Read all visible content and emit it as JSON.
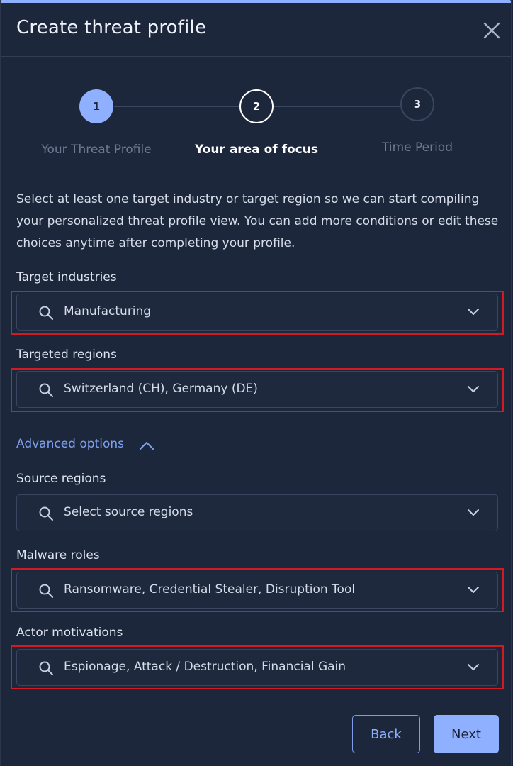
{
  "dialog": {
    "title": "Create threat profile"
  },
  "stepper": {
    "steps": [
      {
        "number": "1",
        "label": "Your Threat Profile",
        "state": "completed"
      },
      {
        "number": "2",
        "label": "Your area of focus",
        "state": "active"
      },
      {
        "number": "3",
        "label": "Time Period",
        "state": "upcoming"
      }
    ]
  },
  "description": "Select at least one target industry or target region so we can start compiling your personalized threat profile view. You can add more conditions or edit these choices anytime after completing your profile.",
  "fields": {
    "target_industries": {
      "label": "Target industries",
      "value": "Manufacturing"
    },
    "targeted_regions": {
      "label": "Targeted regions",
      "value": "Switzerland (CH), Germany (DE)"
    },
    "source_regions": {
      "label": "Source regions",
      "placeholder": "Select source regions"
    },
    "malware_roles": {
      "label": "Malware roles",
      "value": "Ransomware, Credential Stealer, Disruption Tool"
    },
    "actor_motivations": {
      "label": "Actor motivations",
      "value": "Espionage, Attack / Destruction, Financial Gain"
    }
  },
  "advanced_options": {
    "label": "Advanced options"
  },
  "buttons": {
    "back": "Back",
    "next": "Next"
  },
  "colors": {
    "accent": "#8fb0ff",
    "highlight_box": "#d11a22",
    "background": "#1d273b"
  },
  "icons": [
    "close-icon",
    "search-icon",
    "chevron-down-icon",
    "chevron-up-icon"
  ]
}
